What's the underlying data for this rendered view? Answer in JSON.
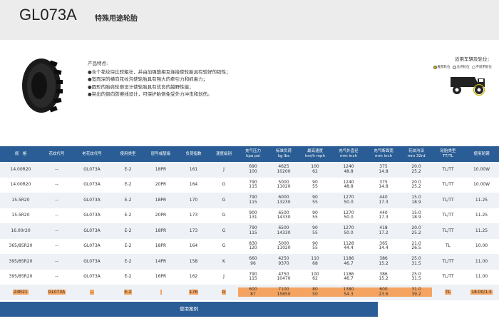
{
  "header": {
    "model": "GL073A",
    "category": "特殊用途轮胎"
  },
  "features": {
    "title": "产品特点:",
    "items": [
      "●含个花纹块比较粗壮，并由加强筋相互连接使轮胎具有较好的韧性；",
      "●宽而深的横向花纹沟使轮胎具有强大的牵引力和抓着力；",
      "●圆形的胎肩轮廓设计使轮胎具有优良的越野性能；",
      "●突出的倒向防擦线设计，可保护胎侧免受外力冲击和划伤。"
    ]
  },
  "application": {
    "title": "适用车辆及轮位：",
    "legend": [
      {
        "label": "推荐轮位",
        "kind": "primary"
      },
      {
        "label": "允许轮位",
        "kind": "ok"
      },
      {
        "label": "不适用轮位",
        "kind": "no"
      }
    ],
    "vehicle_icon": "mining-truck-icon"
  },
  "table": {
    "columns": [
      [
        "规　格",
        ""
      ],
      [
        "花纹代号",
        ""
      ],
      [
        "老花纹代号",
        ""
      ],
      [
        "使用类型",
        ""
      ],
      [
        "层号或层级",
        ""
      ],
      [
        "负荷指数",
        ""
      ],
      [
        "速度级别",
        ""
      ],
      [
        "充气压力",
        "kpa psi"
      ],
      [
        "标准负荷",
        "kg lbs"
      ],
      [
        "最高速度",
        "km/h mph"
      ],
      [
        "充气外直径",
        "mm inch"
      ],
      [
        "充气断面宽",
        "mm inch"
      ],
      [
        "花纹沟深",
        "mm 32rd"
      ],
      [
        "轮胎类型",
        "TT/TL"
      ],
      [
        "使用轮辋",
        ""
      ]
    ],
    "rows": [
      [
        "14.00R20",
        "--",
        "GL073A",
        "E-2",
        "18PR",
        "161",
        "J",
        [
          "690",
          "100"
        ],
        [
          "4625",
          "10200"
        ],
        [
          "100",
          "62"
        ],
        [
          "1240",
          "48.8"
        ],
        [
          "375",
          "14.8"
        ],
        [
          "20.0",
          "25.2"
        ],
        "TL/TT",
        "10.00W"
      ],
      [
        "14.00R20",
        "--",
        "GL073A",
        "E-2",
        "20PR",
        "164",
        "G",
        [
          "790",
          "115"
        ],
        [
          "5000",
          "11020"
        ],
        [
          "90",
          "55"
        ],
        [
          "1240",
          "48.8"
        ],
        [
          "375",
          "14.8"
        ],
        [
          "20.0",
          "25.2"
        ],
        "TL/TT",
        "10.00W"
      ],
      [
        "15.5R20",
        "--",
        "GL073A",
        "E-2",
        "18PR",
        "170",
        "G",
        [
          "790",
          "115"
        ],
        [
          "6000",
          "13230"
        ],
        [
          "90",
          "55"
        ],
        [
          "1270",
          "50.0"
        ],
        [
          "440",
          "17.3"
        ],
        [
          "15.0",
          "18.9"
        ],
        "TL/TT",
        "11.25"
      ],
      [
        "15.5R20",
        "--",
        "GL073A",
        "E-2",
        "20PR",
        "173",
        "G",
        [
          "900",
          "131"
        ],
        [
          "6500",
          "14330"
        ],
        [
          "90",
          "55"
        ],
        [
          "1270",
          "50.0"
        ],
        [
          "440",
          "17.3"
        ],
        [
          "15.0",
          "18.9"
        ],
        "TL/TT",
        "11.25"
      ],
      [
        "16.00r20",
        "--",
        "GL073A",
        "E-2",
        "18PR",
        "173",
        "G",
        [
          "790",
          "115"
        ],
        [
          "6500",
          "14330"
        ],
        [
          "90",
          "55"
        ],
        [
          "1270",
          "50.0"
        ],
        [
          "418",
          "17.2"
        ],
        [
          "20.0",
          "25.2"
        ],
        "TL/TT",
        "11.25"
      ],
      [
        "365/85R20",
        "--",
        "GL073A",
        "E-2",
        "18PR",
        "164",
        "G",
        [
          "830",
          "120"
        ],
        [
          "5000",
          "11020"
        ],
        [
          "90",
          "55"
        ],
        [
          "1128",
          "44.4"
        ],
        [
          "365",
          "14.4"
        ],
        [
          "21.0",
          "26.5"
        ],
        "TL",
        "10.00"
      ],
      [
        "395/85R20",
        "--",
        "GL073A",
        "E-2",
        "14PR",
        "158",
        "K",
        [
          "660",
          "96"
        ],
        [
          "4250",
          "9370"
        ],
        [
          "110",
          "68"
        ],
        [
          "1186",
          "46.7"
        ],
        [
          "386",
          "15.2"
        ],
        [
          "25.0",
          "31.5"
        ],
        "TL/TT",
        "11.00"
      ],
      [
        "395/85R20",
        "--",
        "GL073A",
        "E-2",
        "16PR",
        "162",
        "J",
        [
          "790",
          "115"
        ],
        [
          "4750",
          "10470"
        ],
        [
          "100",
          "62"
        ],
        [
          "1186",
          "46.7"
        ],
        [
          "386",
          "15.2"
        ],
        [
          "25.0",
          "31.5"
        ],
        "TL/TT",
        "11.00"
      ],
      [
        "24R21",
        "GL073A",
        "--",
        "E-2",
        "",
        "176",
        "G",
        [
          "600",
          "87"
        ],
        [
          "7100",
          "15650"
        ],
        [
          "80",
          "50"
        ],
        [
          "1380",
          "54.3"
        ],
        [
          "600",
          "23.6"
        ],
        [
          "31.0",
          "39.2"
        ],
        "TL",
        "18.00/1.5"
      ]
    ]
  },
  "footer": {
    "label": "使用案例"
  },
  "colors": {
    "header_bg": "#ececec",
    "table_header": "#2a5d95",
    "highlight": "#f4a460",
    "row_alt": "#eef1f6"
  }
}
